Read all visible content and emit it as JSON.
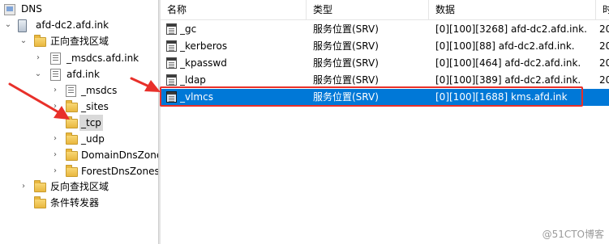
{
  "tree": {
    "root": "DNS",
    "server": "afd-dc2.afd.ink",
    "forward_zones": "正向查找区域",
    "msdcs_zone": "_msdcs.afd.ink",
    "afd_zone": "afd.ink",
    "sub": {
      "msdcs": "_msdcs",
      "sites": "_sites",
      "tcp": "_tcp",
      "udp": "_udp",
      "domain_dns_zones": "DomainDnsZones",
      "forest_dns_zones": "ForestDnsZones"
    },
    "reverse_zones": "反向查找区域",
    "conditional_forwarders": "条件转发器"
  },
  "list": {
    "columns": {
      "name": "名称",
      "type": "类型",
      "data": "数据",
      "time": "时"
    },
    "rows": [
      {
        "name": "_gc",
        "type": "服务位置(SRV)",
        "data": "[0][100][3268] afd-dc2.afd.ink.",
        "time": "20"
      },
      {
        "name": "_kerberos",
        "type": "服务位置(SRV)",
        "data": "[0][100][88] afd-dc2.afd.ink.",
        "time": "20"
      },
      {
        "name": "_kpasswd",
        "type": "服务位置(SRV)",
        "data": "[0][100][464] afd-dc2.afd.ink.",
        "time": "20"
      },
      {
        "name": "_ldap",
        "type": "服务位置(SRV)",
        "data": "[0][100][389] afd-dc2.afd.ink.",
        "time": "20"
      },
      {
        "name": "_vlmcs",
        "type": "服务位置(SRV)",
        "data": "[0][100][1688] kms.afd.ink",
        "time": ""
      }
    ],
    "selected_row": 4
  },
  "annotation": {
    "highlight_color": "#e8302a",
    "selection_color": "#0078d7"
  },
  "watermark": "@51CTO博客"
}
